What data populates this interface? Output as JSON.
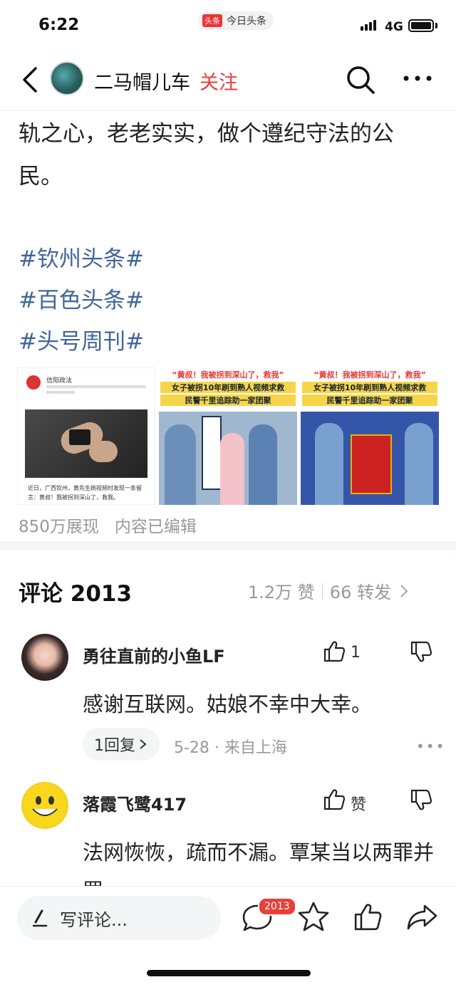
{
  "status_bar": {
    "time": "6:22",
    "app_badge": "头条",
    "app_name": "今日头条",
    "network": "4G"
  },
  "header": {
    "channel_name": "二马帽儿车",
    "follow_label": "关注"
  },
  "article": {
    "lines": [
      "轨之心，老老实实，做个遵纪守法的公",
      "民。"
    ],
    "hashtags": [
      "#钦州头条#",
      "#百色头条#",
      "#头号周刊#"
    ],
    "thumbnails": [
      {
        "source": "信阳政法",
        "caption": "近日，广西钦州，黄先生刷视频时发现一条留言：黄叔！我被拐到深山了，救我。"
      },
      {
        "headline": "“黄叔！我被拐到深山了，救我”",
        "sub1": "女子被拐10年刷到熟人视频求救",
        "sub2": "民警千里追踪助一家团聚"
      },
      {
        "headline": "“黄叔！我被拐到深山了，救我”",
        "sub1": "女子被拐10年刷到熟人视频求救",
        "sub2": "民警千里追踪助一家团聚"
      }
    ],
    "views": "850万展现",
    "edited": "内容已编辑"
  },
  "comments_header": {
    "title": "评论 2013",
    "likes": "1.2万 赞",
    "shares": "66 转发"
  },
  "comments": [
    {
      "user": "勇往直前的小鱼LF",
      "like_count": "1",
      "text": "感谢互联网。姑娘不幸中大幸。",
      "reply_label": "1回复",
      "meta": "5-28 · 来自上海"
    },
    {
      "user": "落霞飞鹭417",
      "like_count": "赞",
      "text": "法网恢恢，疏而不漏。覃某当以两罪并罚"
    }
  ],
  "bottom_bar": {
    "write_placeholder": "写评论...",
    "comment_badge": "2013"
  }
}
